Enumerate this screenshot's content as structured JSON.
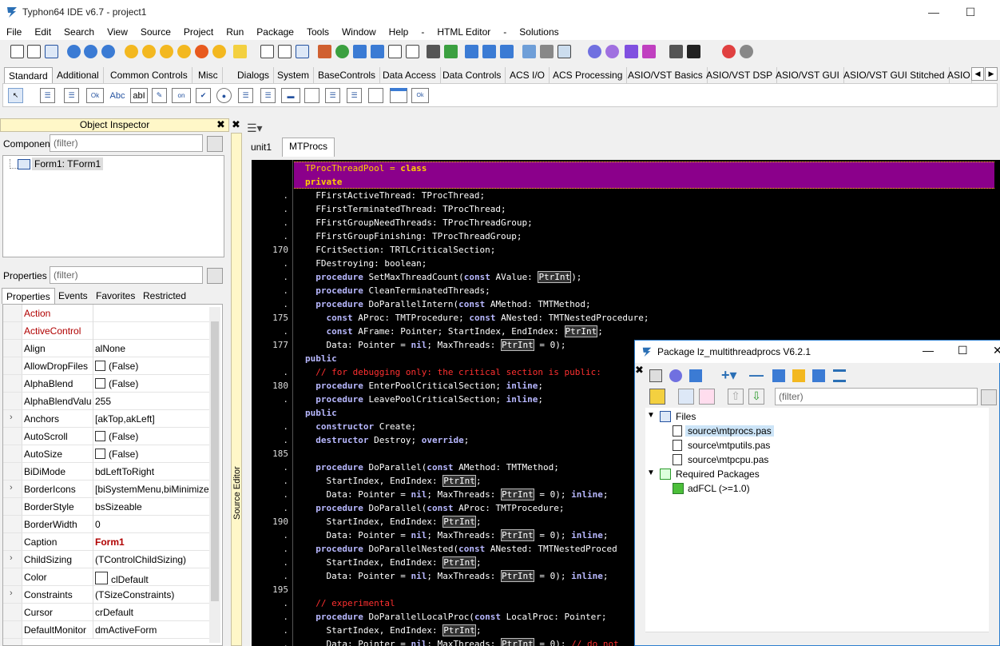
{
  "window": {
    "title": "Typhon64 IDE v6.7 - project1"
  },
  "menu": [
    "File",
    "Edit",
    "Search",
    "View",
    "Source",
    "Project",
    "Run",
    "Package",
    "Tools",
    "Window",
    "Help",
    "-",
    "HTML Editor",
    "-",
    "Solutions"
  ],
  "palette_tabs": [
    "Standard",
    "Additional",
    "Common Controls",
    "Misc",
    "Dialogs",
    "System",
    "BaseControls",
    "Data Access",
    "Data Controls",
    "ACS I/O",
    "ACS Processing",
    "ASIO/VST Basics",
    "ASIO/VST DSP",
    "ASIO/VST GUI",
    "ASIO/VST GUI Stitched",
    "ASIO"
  ],
  "palette_icon_labels": [
    "Ok",
    "Abc",
    "abI",
    "on",
    "Ok"
  ],
  "object_inspector": {
    "title": "Object Inspector",
    "components_label": "Components",
    "filter_placeholder": "(filter)",
    "tree_item": "Form1: TForm1",
    "properties_label": "Properties",
    "tabs": [
      "Properties",
      "Events",
      "Favorites",
      "Restricted"
    ],
    "props": [
      {
        "name": "Action",
        "value": "",
        "red": true
      },
      {
        "name": "ActiveControl",
        "value": "",
        "red": true
      },
      {
        "name": "Align",
        "value": "alNone"
      },
      {
        "name": "AllowDropFiles",
        "value": "(False)",
        "check": true
      },
      {
        "name": "AlphaBlend",
        "value": "(False)",
        "check": true
      },
      {
        "name": "AlphaBlendValu",
        "value": "255"
      },
      {
        "name": "Anchors",
        "value": "[akTop,akLeft]",
        "expand": true
      },
      {
        "name": "AutoScroll",
        "value": "(False)",
        "check": true
      },
      {
        "name": "AutoSize",
        "value": "(False)",
        "check": true
      },
      {
        "name": "BiDiMode",
        "value": "bdLeftToRight"
      },
      {
        "name": "BorderIcons",
        "value": "[biSystemMenu,biMinimize",
        "expand": true
      },
      {
        "name": "BorderStyle",
        "value": "bsSizeable"
      },
      {
        "name": "BorderWidth",
        "value": "0"
      },
      {
        "name": "Caption",
        "value": "Form1",
        "boldred": true
      },
      {
        "name": "ChildSizing",
        "value": "(TControlChildSizing)",
        "expand": true
      },
      {
        "name": "Color",
        "value": "clDefault",
        "swatch": true
      },
      {
        "name": "Constraints",
        "value": "(TSizeConstraints)",
        "expand": true
      },
      {
        "name": "Cursor",
        "value": "crDefault"
      },
      {
        "name": "DefaultMonitor",
        "value": "dmActiveForm"
      }
    ]
  },
  "editor": {
    "tabs": [
      "unit1",
      "MTProcs"
    ],
    "side_label": "Source Editor",
    "lines": [
      {
        "n": "",
        "t": "TProcThreadPool = class",
        "hl": true
      },
      {
        "n": "",
        "t": "private",
        "hl": true
      },
      {
        "n": ".",
        "t": "  FFirstActiveThread: TProcThread;"
      },
      {
        "n": ".",
        "t": "  FFirstTerminatedThread: TProcThread;"
      },
      {
        "n": ".",
        "t": "  FFirstGroupNeedThreads: TProcThreadGroup;"
      },
      {
        "n": ".",
        "t": "  FFirstGroupFinishing: TProcThreadGroup;"
      },
      {
        "n": "170",
        "t": "  FCritSection: TRTLCriticalSection;"
      },
      {
        "n": ".",
        "t": "  FDestroying: boolean;"
      },
      {
        "n": ".",
        "t": "  procedure SetMaxThreadCount(const AValue: PtrInt);"
      },
      {
        "n": ".",
        "t": "  procedure CleanTerminatedThreads;"
      },
      {
        "n": ".",
        "t": "  procedure DoParallelIntern(const AMethod: TMTMethod;"
      },
      {
        "n": "175",
        "t": "    const AProc: TMTProcedure; const ANested: TMTNestedProcedure;"
      },
      {
        "n": ".",
        "t": "    const AFrame: Pointer; StartIndex, EndIndex: PtrInt;"
      },
      {
        "n": "177",
        "t": "    Data: Pointer = nil; MaxThreads: PtrInt = 0);"
      },
      {
        "n": "",
        "t": "public"
      },
      {
        "n": ".",
        "t": "  // for debugging only: the critical section is public:"
      },
      {
        "n": "180",
        "t": "  procedure EnterPoolCriticalSection; inline;"
      },
      {
        "n": ".",
        "t": "  procedure LeavePoolCriticalSection; inline;"
      },
      {
        "n": "",
        "t": "public"
      },
      {
        "n": ".",
        "t": "  constructor Create;"
      },
      {
        "n": ".",
        "t": "  destructor Destroy; override;"
      },
      {
        "n": "185",
        "t": ""
      },
      {
        "n": ".",
        "t": "  procedure DoParallel(const AMethod: TMTMethod;"
      },
      {
        "n": ".",
        "t": "    StartIndex, EndIndex: PtrInt;"
      },
      {
        "n": ".",
        "t": "    Data: Pointer = nil; MaxThreads: PtrInt = 0); inline;"
      },
      {
        "n": ".",
        "t": "  procedure DoParallel(const AProc: TMTProcedure;"
      },
      {
        "n": "190",
        "t": "    StartIndex, EndIndex: PtrInt;"
      },
      {
        "n": ".",
        "t": "    Data: Pointer = nil; MaxThreads: PtrInt = 0); inline;"
      },
      {
        "n": ".",
        "t": "  procedure DoParallelNested(const ANested: TMTNestedProced"
      },
      {
        "n": ".",
        "t": "    StartIndex, EndIndex: PtrInt;"
      },
      {
        "n": ".",
        "t": "    Data: Pointer = nil; MaxThreads: PtrInt = 0); inline;"
      },
      {
        "n": "195",
        "t": ""
      },
      {
        "n": ".",
        "t": "  // experimental"
      },
      {
        "n": ".",
        "t": "  procedure DoParallelLocalProc(const LocalProc: Pointer;"
      },
      {
        "n": ".",
        "t": "    StartIndex, EndIndex: PtrInt;"
      },
      {
        "n": ".",
        "t": "    Data: Pointer = nil; MaxThreads: PtrInt = 0); // do not"
      }
    ]
  },
  "package_window": {
    "title": "Package lz_multithreadprocs V6.2.1",
    "filter_placeholder": "(filter)",
    "files_label": "Files",
    "files": [
      "source\\mtprocs.pas",
      "source\\mtputils.pas",
      "source\\mtpcpu.pas"
    ],
    "required_label": "Required Packages",
    "required": [
      "adFCL (>=1.0)"
    ]
  },
  "colors": {
    "editor_bg": "#000000",
    "highlight": "#8b008b",
    "keyword": "#b8b8ff",
    "comment": "#ff3030",
    "inspector_header": "#fff7c8"
  }
}
